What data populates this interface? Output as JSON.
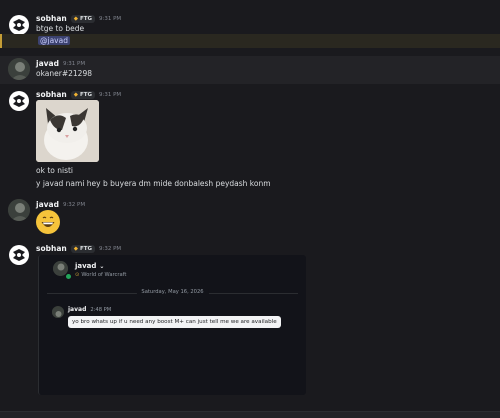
{
  "messages": [
    {
      "user": "sobhan",
      "tag": "FTG",
      "time": "9:31 PM",
      "lines": [
        "btge to bede"
      ],
      "mention": "@javad"
    },
    {
      "user": "javad",
      "time": "9:31 PM",
      "lines": [
        "okaner#21298"
      ]
    },
    {
      "user": "sobhan",
      "tag": "FTG",
      "time": "9:31 PM",
      "lines": [
        "ok to nisti",
        "y javad nami hey b buyera dm mide donbalesh peydash konm"
      ]
    },
    {
      "user": "javad",
      "time": "9:32 PM"
    },
    {
      "user": "sobhan",
      "tag": "FTG",
      "time": "9:32 PM"
    }
  ],
  "embed": {
    "name": "javad",
    "game": "World of Warcraft",
    "date": "Saturday, May 16, 2026",
    "inner_user": "javad",
    "inner_time": "2:48 PM",
    "inner_text": "yo bro whats up if u need any boost M+ can just tell me we are available"
  },
  "icons": {
    "status": "online-dot",
    "emoji": "grinning-face"
  },
  "colors": {
    "accent": "#c59d36",
    "mention_bg": "#3c4270",
    "online": "#23a55a"
  }
}
